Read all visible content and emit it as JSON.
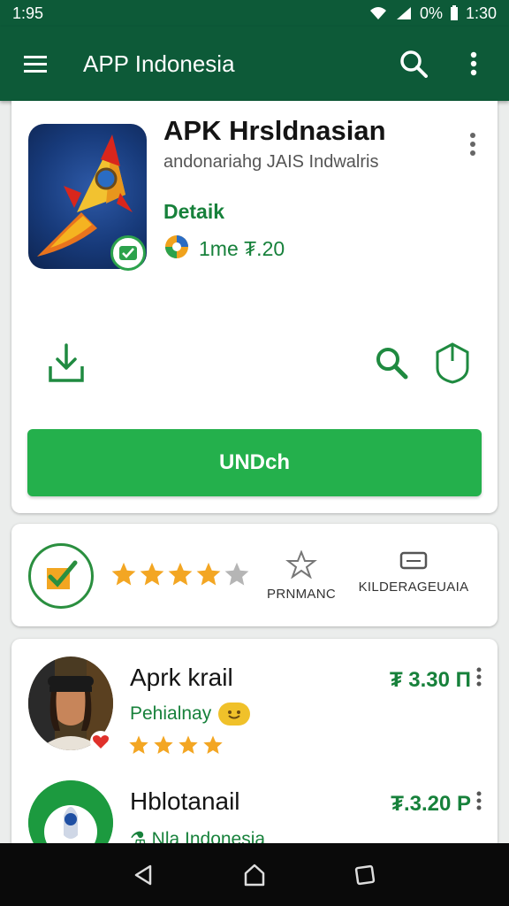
{
  "status_bar": {
    "left_time": "1:95",
    "battery": "0%",
    "right_time": "1:30"
  },
  "app_bar": {
    "title": "APP Indonesia",
    "icons": [
      "menu-icon",
      "search-icon",
      "more-vert-icon"
    ],
    "bg_color": "#0d5a38"
  },
  "app_card": {
    "title": "APK Hrsldnasian",
    "subtitle": "andonariahg JAIS Indwalris",
    "detail_label": "Detaik",
    "time_label": "1me ₮.20",
    "install_label": "UNDch",
    "accent_color": "#24b04c"
  },
  "rating_card": {
    "stars_filled": 4,
    "stars_total": 5,
    "stat1_label": "PRNMANC",
    "stat2_label": "KILDERAGEUAIA"
  },
  "list": [
    {
      "title": "Aprk krail",
      "subtitle": "Pehialnay",
      "price": "₮ 3.30 Π",
      "stars_filled": 4
    },
    {
      "title": "Hblotanail",
      "subtitle": "⚗ Nla Indonesia",
      "price": "₮.3.20 P"
    }
  ],
  "nav_bar": {
    "icons": [
      "back-icon",
      "home-icon",
      "recents-icon"
    ]
  }
}
